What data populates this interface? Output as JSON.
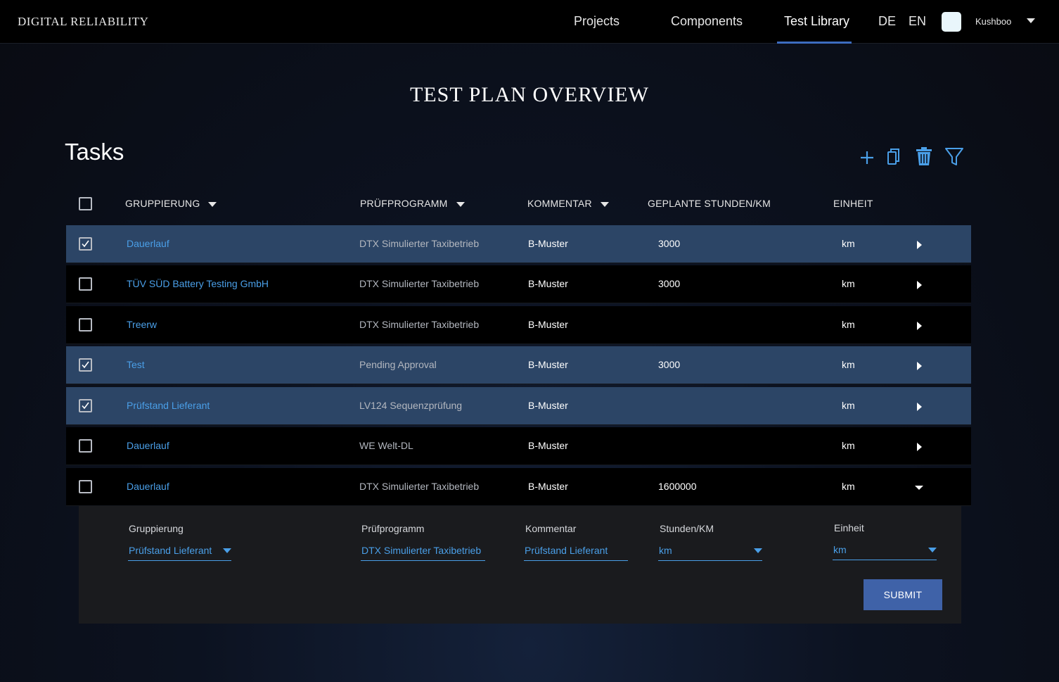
{
  "brand": "DIGITAL RELIABILITY",
  "nav": {
    "projects": "Projects",
    "components": "Components",
    "test_library": "Test Library",
    "lang_de": "DE",
    "lang_en": "EN",
    "username": "Kushboo"
  },
  "page_title": "TEST PLAN OVERVIEW",
  "section_title": "Tasks",
  "toolbar": {
    "icons": [
      "plus-icon",
      "copy-icon",
      "trash-icon",
      "filter-icon"
    ],
    "accent_color": "#4a9fe8"
  },
  "columns": {
    "group": "GRUPPIERUNG",
    "program": "PRÜFPROGRAMM",
    "comment": "KOMMENTAR",
    "hours": "GEPLANTE STUNDEN/KM",
    "unit": "EINHEIT"
  },
  "rows": [
    {
      "selected": true,
      "group": "Dauerlauf",
      "program": "DTX Simulierter Taxibetrieb",
      "comment": "B-Muster",
      "hours": "3000",
      "unit": "km",
      "expanded": false
    },
    {
      "selected": false,
      "group": "TÜV SÜD Battery Testing GmbH",
      "program": "DTX Simulierter Taxibetrieb",
      "comment": "B-Muster",
      "hours": "3000",
      "unit": "km",
      "expanded": false
    },
    {
      "selected": false,
      "group": "Treerw",
      "program": "DTX Simulierter Taxibetrieb",
      "comment": "B-Muster",
      "hours": "",
      "unit": "km",
      "expanded": false
    },
    {
      "selected": true,
      "group": "Test",
      "program": "Pending Approval",
      "comment": "B-Muster",
      "hours": "3000",
      "unit": "km",
      "expanded": false
    },
    {
      "selected": true,
      "group": "Prüfstand Lieferant",
      "program": "LV124 Sequenzprüfung",
      "comment": "B-Muster",
      "hours": "",
      "unit": "km",
      "expanded": false
    },
    {
      "selected": false,
      "group": "Dauerlauf",
      "program": "WE Welt-DL",
      "comment": "B-Muster",
      "hours": "",
      "unit": "km",
      "expanded": false
    },
    {
      "selected": false,
      "group": "Dauerlauf",
      "program": "DTX Simulierter Taxibetrieb",
      "comment": "B-Muster",
      "hours": "1600000",
      "unit": "km",
      "expanded": true
    }
  ],
  "edit_form": {
    "group_label": "Gruppierung",
    "group_value": "Prüfstand Lieferant",
    "program_label": "Prüfprogramm",
    "program_value": "DTX Simulierter Taxibetrieb",
    "comment_label": "Kommentar",
    "comment_value": "Prüfstand Lieferant",
    "hours_label": "Stunden/KM",
    "hours_value": "km",
    "unit_label": "Einheit",
    "unit_value": "km",
    "submit_label": "SUBMIT"
  },
  "colors": {
    "selected_row": "#2c4566",
    "link_blue": "#4a9fe8",
    "submit_button": "#3f62a8",
    "nav_underline": "#3d6cbf"
  }
}
